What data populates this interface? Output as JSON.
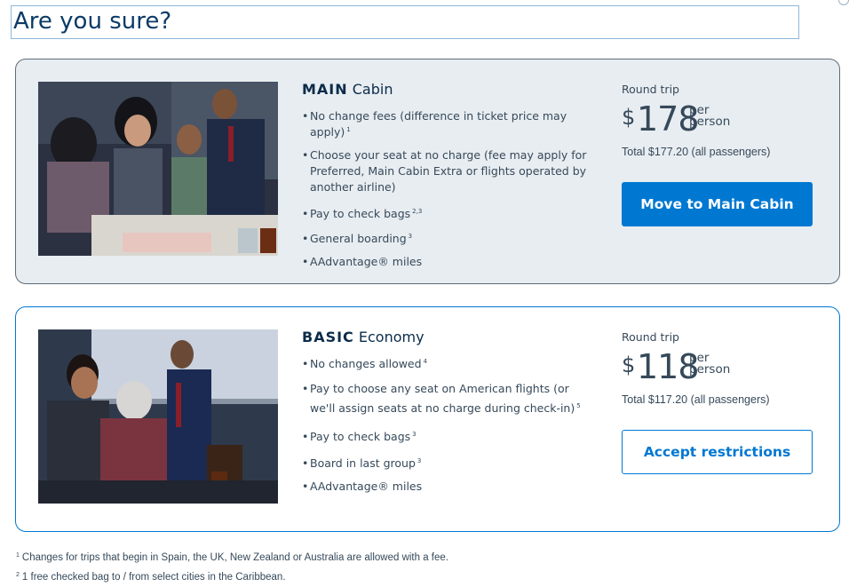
{
  "dialog": {
    "title": "Are you sure?"
  },
  "main_cabin": {
    "name_strong": "MAIN",
    "name_rest": "Cabin",
    "features": [
      {
        "text": "No change fees (difference in ticket price may apply)",
        "note": "1"
      },
      {
        "text": "Choose your seat at no charge (fee may apply for Preferred, Main Cabin Extra or flights operated by another airline)",
        "note": ""
      },
      {
        "text": "Pay to check bags",
        "note": "2,3"
      },
      {
        "text": "General boarding",
        "note": "3"
      },
      {
        "text": "AAdvantage® miles",
        "note": ""
      }
    ],
    "round_trip_label": "Round trip",
    "currency": "$",
    "price": "178",
    "per_label": "per",
    "person_label": "person",
    "total": "Total $177.20 (all passengers)",
    "button_label": "Move to Main Cabin"
  },
  "basic_economy": {
    "name_strong": "BASIC",
    "name_rest": "Economy",
    "features": [
      {
        "text": "No changes allowed",
        "note": "4"
      },
      {
        "text": "Pay to choose any seat on American flights (or we'll assign seats at no charge during check-in)",
        "note": "5"
      },
      {
        "text": "Pay to check bags",
        "note": "3"
      },
      {
        "text": "Board in last group",
        "note": "3"
      },
      {
        "text": "AAdvantage® miles",
        "note": ""
      }
    ],
    "round_trip_label": "Round trip",
    "currency": "$",
    "price": "118",
    "per_label": "per",
    "person_label": "person",
    "total": "Total $117.20 (all passengers)",
    "button_label": "Accept restrictions"
  },
  "footnotes": [
    {
      "num": "1",
      "text": "Changes for trips that begin in Spain, the UK, New Zealand or Australia are allowed with a fee."
    },
    {
      "num": "2",
      "text": "1 free checked bag to / from select cities in the Caribbean."
    }
  ],
  "colors": {
    "brand_blue": "#0078d2",
    "title_blue": "#0b3a66",
    "main_card_bg": "#e8edf1",
    "text": "#36495a"
  }
}
